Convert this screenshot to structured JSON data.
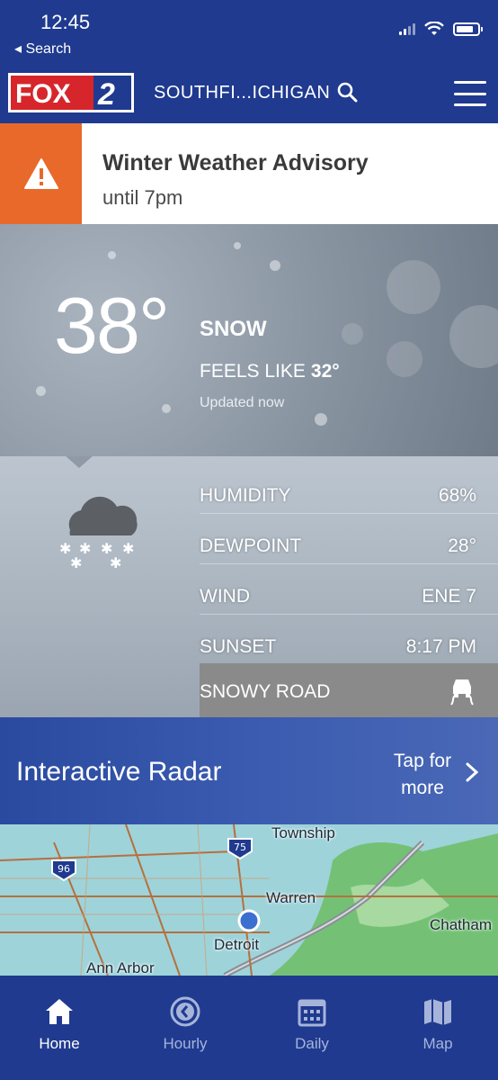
{
  "status_bar": {
    "time": "12:45",
    "back_label": "◂ Search"
  },
  "nav": {
    "logo_text": "FOX 2",
    "location": "SOUTHFI...ICHIGAN"
  },
  "alert": {
    "title": "Winter Weather Advisory",
    "subtitle": "until 7pm",
    "accent_color": "#e8692a"
  },
  "current": {
    "temperature": "38°",
    "condition": "SNOW",
    "feels_like_label": "FEELS LIKE",
    "feels_like_value": "32°",
    "updated": "Updated now"
  },
  "details": {
    "rows": [
      {
        "label": "HUMIDITY",
        "value": "68%"
      },
      {
        "label": "DEWPOINT",
        "value": "28°"
      },
      {
        "label": "WIND",
        "value": "ENE 7"
      },
      {
        "label": "SUNSET",
        "value": "8:17 PM"
      }
    ],
    "road_label": "SNOWY ROAD",
    "condition_icon": "snow-cloud-icon"
  },
  "radar": {
    "title": "Interactive Radar",
    "tap_label": "Tap for more"
  },
  "map": {
    "labels": [
      "Township",
      "Warren",
      "Detroit",
      "Ann Arbor",
      "Chatham"
    ],
    "shields": [
      "96",
      "75"
    ]
  },
  "tabbar": {
    "tabs": [
      {
        "label": "Home",
        "icon": "home-icon",
        "active": true
      },
      {
        "label": "Hourly",
        "icon": "clock-icon",
        "active": false
      },
      {
        "label": "Daily",
        "icon": "calendar-icon",
        "active": false
      },
      {
        "label": "Map",
        "icon": "map-icon",
        "active": false
      }
    ]
  },
  "colors": {
    "brand_blue": "#1f3a8f",
    "active_tab": "#ffffff",
    "inactive_tab": "#a7b4da"
  }
}
